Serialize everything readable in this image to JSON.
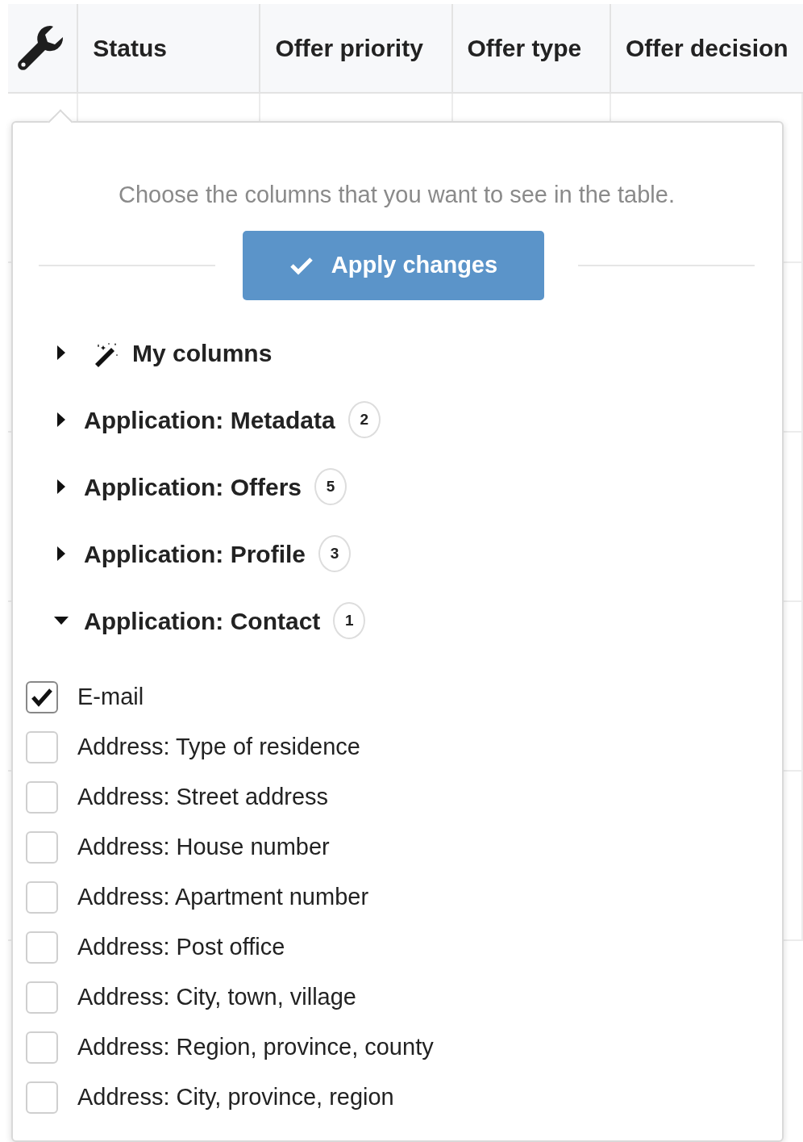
{
  "table": {
    "columns": [
      {
        "kind": "settings"
      },
      {
        "kind": "text",
        "label": "Status"
      },
      {
        "kind": "text",
        "label": "Offer priority"
      },
      {
        "kind": "text",
        "label": "Offer type"
      },
      {
        "kind": "text",
        "label": "Offer decision"
      }
    ]
  },
  "column_chooser": {
    "description": "Choose the columns that you want to see in the table.",
    "apply_button": "Apply changes",
    "groups": [
      {
        "kind": "favorites",
        "label": "My columns",
        "expanded": false
      },
      {
        "kind": "group",
        "label": "Application: Metadata",
        "count": "2",
        "expanded": false
      },
      {
        "kind": "group",
        "label": "Application: Offers",
        "count": "5",
        "expanded": false
      },
      {
        "kind": "group",
        "label": "Application: Profile",
        "count": "3",
        "expanded": false
      },
      {
        "kind": "group",
        "label": "Application: Contact",
        "count": "1",
        "expanded": true,
        "children": [
          {
            "label": "E-mail",
            "checked": true
          },
          {
            "label": "Address: Type of residence",
            "checked": false
          },
          {
            "label": "Address: Street address",
            "checked": false
          },
          {
            "label": "Address: House number",
            "checked": false
          },
          {
            "label": "Address: Apartment number",
            "checked": false
          },
          {
            "label": "Address: Post office",
            "checked": false
          },
          {
            "label": "Address: City, town, village",
            "checked": false
          },
          {
            "label": "Address: Region, province, county",
            "checked": false
          },
          {
            "label": "Address: City, province, region",
            "checked": false
          }
        ]
      }
    ]
  }
}
